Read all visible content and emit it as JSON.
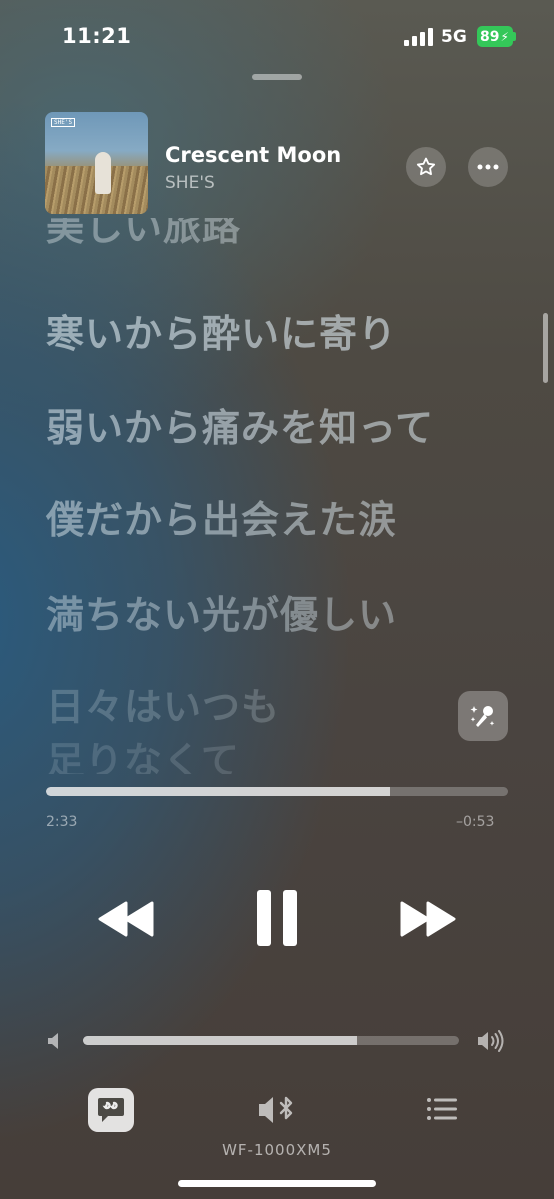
{
  "status_bar": {
    "time": "11:21",
    "network": "5G",
    "battery_percent": "89",
    "battery_color": "#34c759",
    "signal_bars": 4
  },
  "now_playing": {
    "title": "Crescent Moon",
    "artist": "SHE'S",
    "artwork_text": "SHE'S"
  },
  "lyrics": {
    "partial_top": "美しい旅路",
    "lines": [
      "寒いから酔いに寄り",
      "弱いから痛みを知って",
      "僕だから出会えた涙",
      "満ちない光が優しい",
      "日々はいつも",
      "足りなくて"
    ]
  },
  "playback": {
    "elapsed": "2:33",
    "remaining": "–0:53",
    "progress_fraction": 0.745
  },
  "volume": {
    "level_fraction": 0.73
  },
  "output": {
    "device_name": "WF-1000XM5"
  },
  "icons": {
    "star": "star-icon",
    "more": "ellipsis-icon",
    "sing": "microphone-sparkle-icon",
    "rewind": "backward-icon",
    "pause": "pause-icon",
    "forward": "forward-icon",
    "lyrics": "quote-bubble-icon",
    "output": "speaker-bluetooth-icon",
    "queue": "list-icon"
  }
}
